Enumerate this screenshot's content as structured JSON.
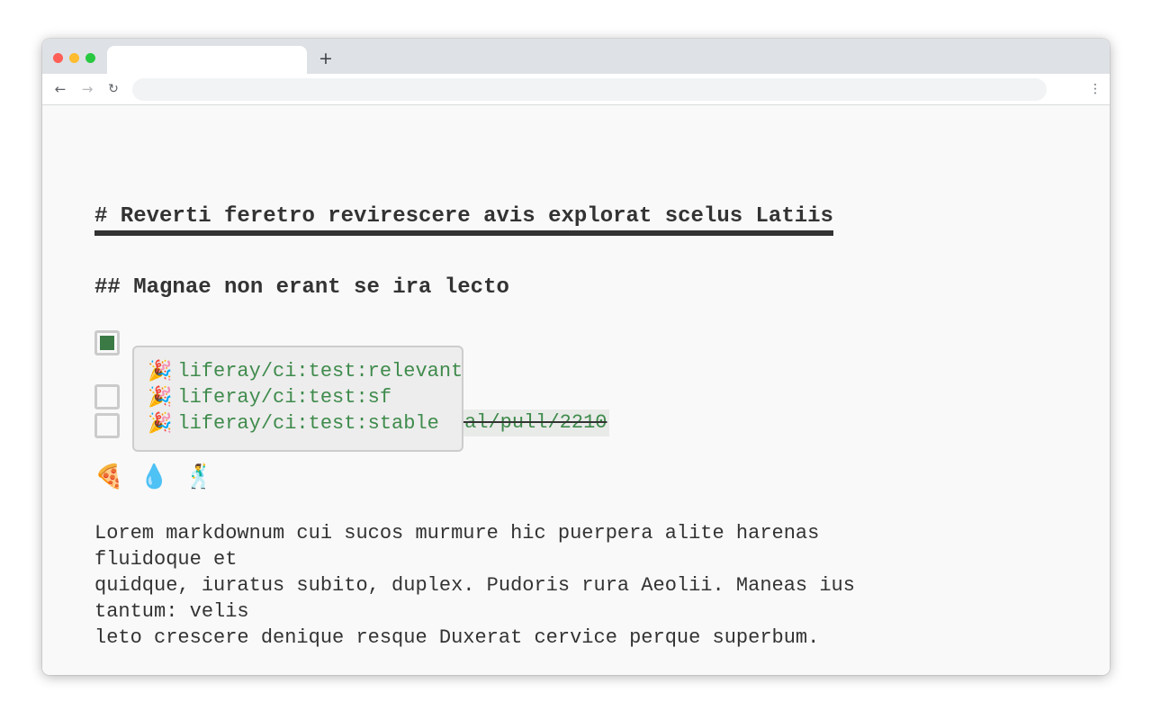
{
  "browser": {
    "new_tab_label": "+",
    "back_icon": "←",
    "forward_icon": "→",
    "reload_icon": "↻",
    "menu_icon": "⋮"
  },
  "document": {
    "heading1": "# Reverti feretro revirescere avis explorat scelus Latiis",
    "heading2": "## Magnae non erant se ira lecto",
    "task_list": [
      {
        "checked": true
      },
      {
        "checked": false
      },
      {
        "checked": false,
        "emoji": "🎉",
        "label": "liferay-echo/liferay-portal/pull/2210",
        "strikethrough": true
      }
    ],
    "dropdown": {
      "items": [
        {
          "emoji": "🎉",
          "label": "liferay/ci:test:relevant"
        },
        {
          "emoji": "🎉",
          "label": "liferay/ci:test:sf"
        },
        {
          "emoji": "🎉",
          "label": "liferay/ci:test:stable"
        }
      ]
    },
    "emoji_row": [
      "🍕",
      "💧",
      "🕺"
    ],
    "paragraph": "Lorem markdownum cui sucos murmure hic puerpera alite harenas\nfluidoque et\nquidque, iuratus subito, duplex. Pudoris rura Aeolii. Maneas ius\ntantum: velis\nleto crescere denique resque Duxerat cervice perque superbum."
  },
  "colors": {
    "link_green": "#3f8b4c",
    "checkbox_fill": "#3b7a45",
    "text": "#333333"
  }
}
